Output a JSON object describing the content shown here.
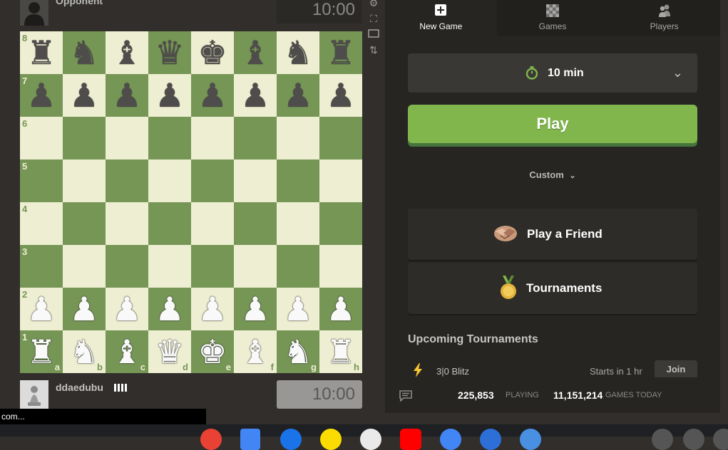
{
  "opponent": {
    "name": "Opponent",
    "clock": "10:00"
  },
  "player": {
    "name": "ddaedubu",
    "clock": "10:00"
  },
  "board": {
    "ranks": [
      "8",
      "7",
      "6",
      "5",
      "4",
      "3",
      "2",
      "1"
    ],
    "files": [
      "a",
      "b",
      "c",
      "d",
      "e",
      "f",
      "g",
      "h"
    ],
    "rows": [
      [
        "br",
        "bn",
        "bb",
        "bq",
        "bk",
        "bb",
        "bn",
        "br"
      ],
      [
        "bp",
        "bp",
        "bp",
        "bp",
        "bp",
        "bp",
        "bp",
        "bp"
      ],
      [
        "",
        "",
        "",
        "",
        "",
        "",
        "",
        ""
      ],
      [
        "",
        "",
        "",
        "",
        "",
        "",
        "",
        ""
      ],
      [
        "",
        "",
        "",
        "",
        "",
        "",
        "",
        ""
      ],
      [
        "",
        "",
        "",
        "",
        "",
        "",
        "",
        ""
      ],
      [
        "wp",
        "wp",
        "wp",
        "wp",
        "wp",
        "wp",
        "wp",
        "wp"
      ],
      [
        "wr",
        "wn",
        "wb",
        "wq",
        "wk",
        "wb",
        "wn",
        "wr"
      ]
    ]
  },
  "tabs": [
    {
      "label": "New Game",
      "icon": "plus-square-icon"
    },
    {
      "label": "Games",
      "icon": "checkerboard-icon"
    },
    {
      "label": "Players",
      "icon": "players-icon"
    }
  ],
  "time_control": {
    "label": "10 min"
  },
  "play_button": "Play",
  "custom_label": "Custom",
  "play_friend": "Play a Friend",
  "tournaments": "Tournaments",
  "upcoming": {
    "heading": "Upcoming Tournaments",
    "items": [
      {
        "name": "3|0 Blitz",
        "start": "Starts in 1 hr",
        "action": "Join"
      }
    ]
  },
  "stats": {
    "playing_count": "225,853",
    "playing_label": "PLAYING",
    "games_count": "11,151,214",
    "games_label": "GAMES TODAY"
  },
  "tooltip": "com...",
  "colors": {
    "accent": "#81b64c",
    "board_light": "#eeeed2",
    "board_dark": "#769656"
  }
}
